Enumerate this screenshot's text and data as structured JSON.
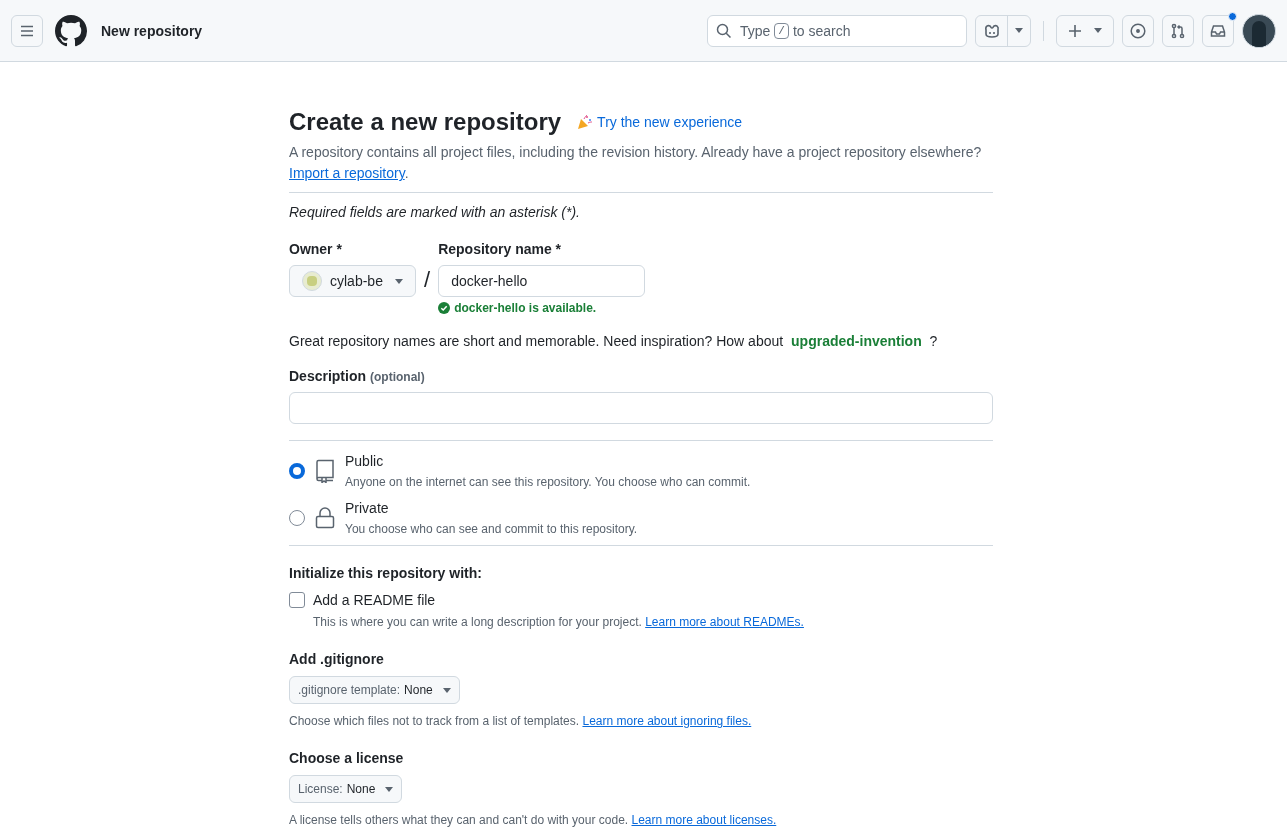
{
  "header": {
    "title": "New repository",
    "search": {
      "before": "Type",
      "key": "/",
      "after": "to search"
    },
    "inbox_unread": true
  },
  "page": {
    "title": "Create a new repository",
    "try_link": "Try the new experience",
    "intro": "A repository contains all project files, including the revision history. Already have a project repository elsewhere?",
    "import_link": "Import a repository",
    "intro_end": ".",
    "required_note": "Required fields are marked with an asterisk (*)."
  },
  "owner": {
    "label": "Owner *",
    "value": "cylab-be",
    "separator": "/"
  },
  "repo_name": {
    "label": "Repository name *",
    "value": "docker-hello",
    "status": "docker-hello is available.",
    "available": true
  },
  "suggestion": {
    "text": "Great repository names are short and memorable. Need inspiration? How about",
    "name": "upgraded-invention",
    "end": "?"
  },
  "description": {
    "label": "Description",
    "optional": "(optional)"
  },
  "visibility": [
    {
      "kind": "public",
      "label": "Public",
      "help": "Anyone on the internet can see this repository. You choose who can commit.",
      "selected": true
    },
    {
      "kind": "private",
      "label": "Private",
      "help": "You choose who can see and commit to this repository.",
      "selected": false
    }
  ],
  "init": {
    "heading": "Initialize this repository with:",
    "readme": {
      "label": "Add a README file",
      "checked": false,
      "help": "This is where you can write a long description for your project.",
      "link": "Learn more about READMEs."
    }
  },
  "selects": [
    {
      "heading": "Add .gitignore",
      "prefix": ".gitignore template:",
      "value": "None",
      "help": "Choose which files not to track from a list of templates.",
      "link": "Learn more about ignoring files."
    },
    {
      "heading": "Choose a license",
      "prefix": "License:",
      "value": "None",
      "help": "A license tells others what they can and can't do with your code.",
      "link": "Learn more about licenses."
    }
  ]
}
